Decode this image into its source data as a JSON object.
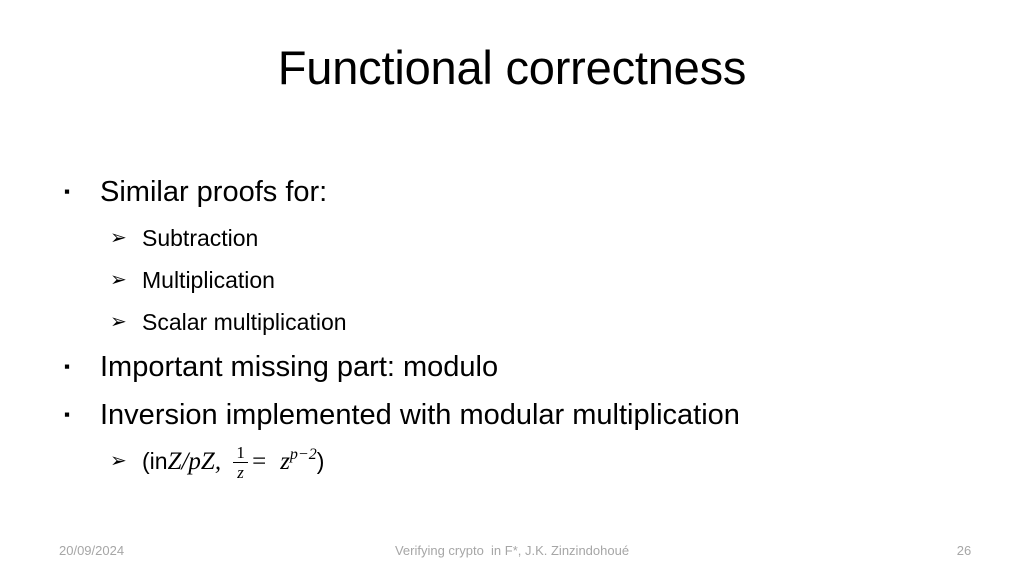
{
  "slide": {
    "title": "Functional correctness",
    "background_color": "#ffffff",
    "text_color": "#000000"
  },
  "bullets": {
    "level1_marker": "▪",
    "level2_marker": "➢",
    "items": [
      {
        "label": "Similar proofs for:"
      },
      {
        "label": "Important missing part: modulo"
      },
      {
        "label": "Inversion implemented with modular multiplication"
      }
    ],
    "sub_items": [
      {
        "label": "Subtraction"
      },
      {
        "label": "Multiplication"
      },
      {
        "label": "Scalar multiplication"
      }
    ]
  },
  "formula": {
    "prefix": "(in ",
    "ring": "Z/pZ",
    "comma": ",",
    "numerator": "1",
    "denominator": "z",
    "equals": "=",
    "base": "z",
    "exponent": "p−2",
    "suffix": ")"
  },
  "footer": {
    "date": "20/09/2024",
    "center": "Verifying crypto  in F*, J.K. Zinzindohoué",
    "page_number": "26",
    "color": "#a6a6a6"
  }
}
